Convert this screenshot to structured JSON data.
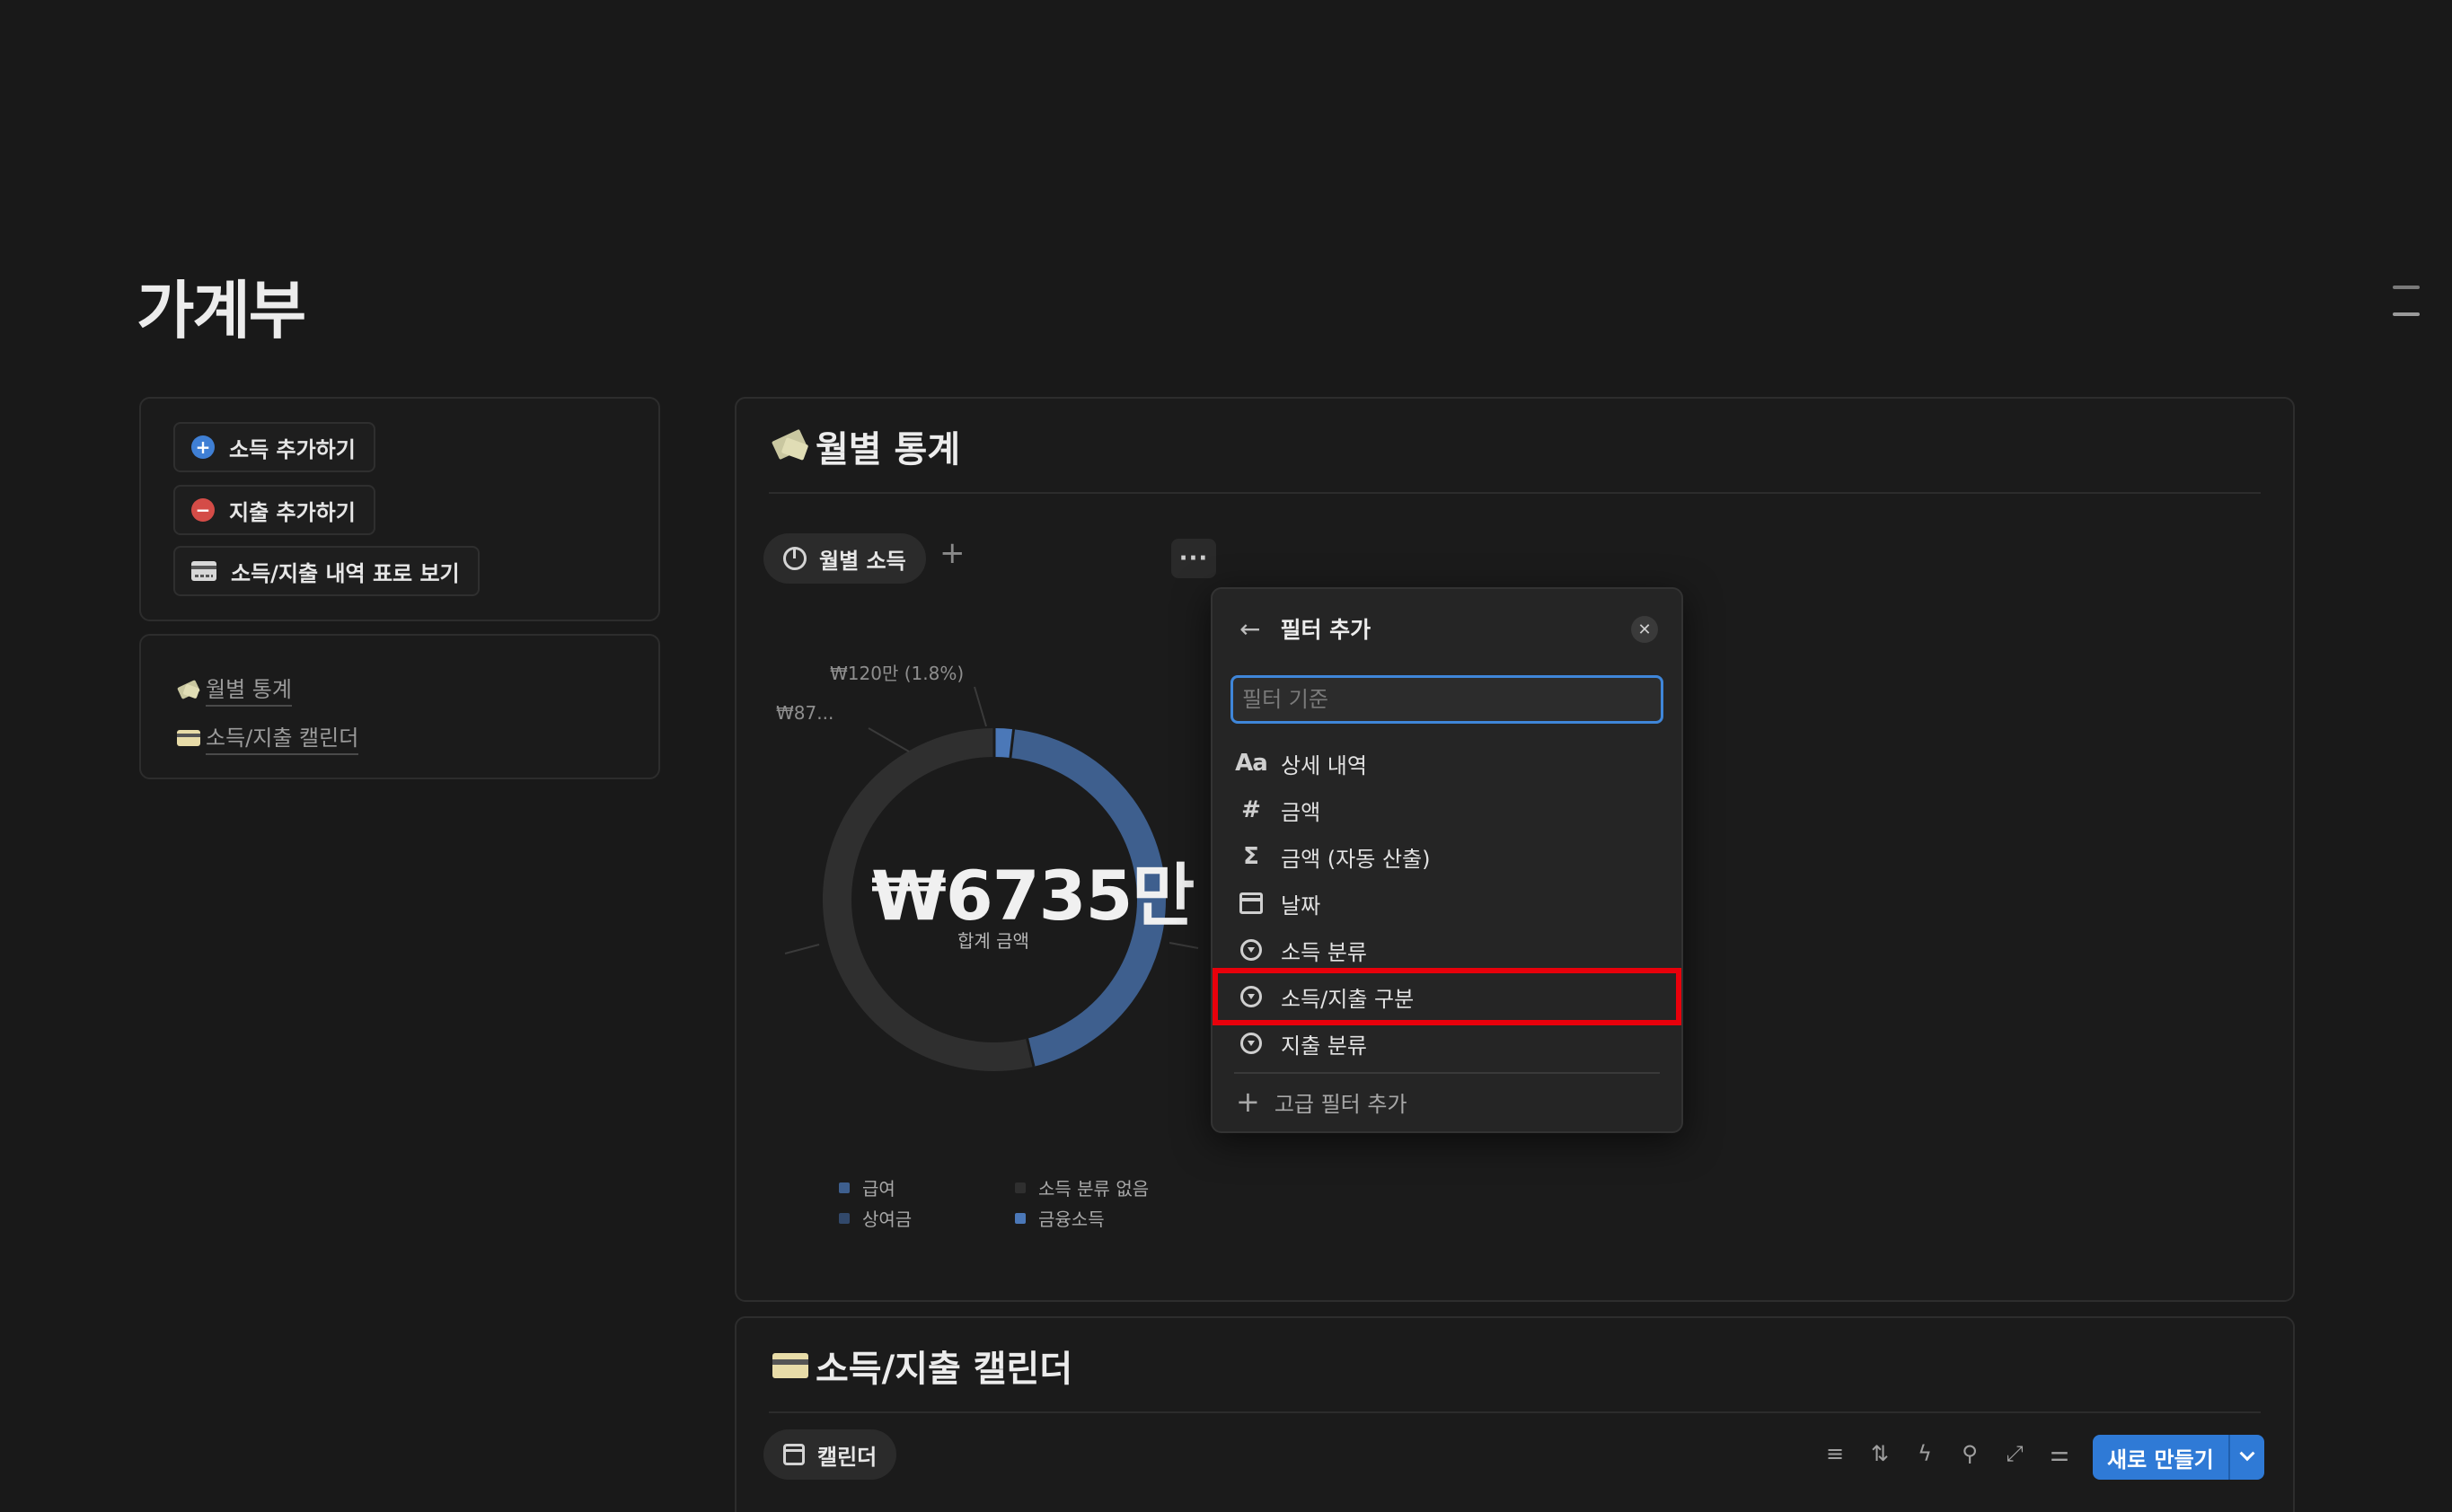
{
  "page": {
    "title": "가계부"
  },
  "left_actions": [
    {
      "label": "소득 추가하기",
      "icon": "plus-circle-icon"
    },
    {
      "label": "지출 추가하기",
      "icon": "minus-circle-icon"
    },
    {
      "label": "소득/지출 내역 표로 보기",
      "icon": "credit-card-icon"
    }
  ],
  "left_links": [
    {
      "label": "월별 통계",
      "icon": "money-wings-icon"
    },
    {
      "label": "소득/지출 캘린더",
      "icon": "credit-card-icon"
    }
  ],
  "stats": {
    "title": "월별 통계",
    "view_tab": "월별 소득",
    "add_view": "+",
    "more": "···"
  },
  "chart_data": {
    "type": "pie",
    "total_label": "₩6735만",
    "total_caption": "합계 금액",
    "slice_labels": [
      "₩120만 (1.8%)",
      "₩87..."
    ],
    "series": [
      {
        "name": "급여",
        "color": "#3e5f8e"
      },
      {
        "name": "상여금",
        "color": "#32496b"
      },
      {
        "name": "소득 분류 없음",
        "color": "#2f2f2f"
      },
      {
        "name": "금융소득",
        "color": "#4b78b8"
      }
    ],
    "segments": [
      {
        "name": "금융소득",
        "pct": 1.8,
        "color": "#4b78b8"
      },
      {
        "name": "급여",
        "pct": 44.5,
        "color": "#3e5f8e"
      },
      {
        "name": "소득 분류 없음",
        "pct": 53.7,
        "color": "#2f2f2f"
      }
    ]
  },
  "calendar": {
    "title": "소득/지출 캘린더",
    "view_tab": "캘린더",
    "new_button": "새로 만들기"
  },
  "filter_popover": {
    "title": "필터 추가",
    "back_icon": "←",
    "close_icon": "✕",
    "search_placeholder": "필터 기준",
    "items": [
      {
        "label": "상세 내역",
        "icon": "Aa"
      },
      {
        "label": "금액",
        "icon": "#"
      },
      {
        "label": "금액 (자동 산출)",
        "icon": "Σ"
      },
      {
        "label": "날짜",
        "icon": "calendar-icon"
      },
      {
        "label": "소득 분류",
        "icon": "select-icon"
      },
      {
        "label": "소득/지출 구분",
        "icon": "select-icon",
        "highlighted": true
      },
      {
        "label": "지출 분류",
        "icon": "select-icon"
      }
    ],
    "advanced": "고급 필터 추가"
  }
}
